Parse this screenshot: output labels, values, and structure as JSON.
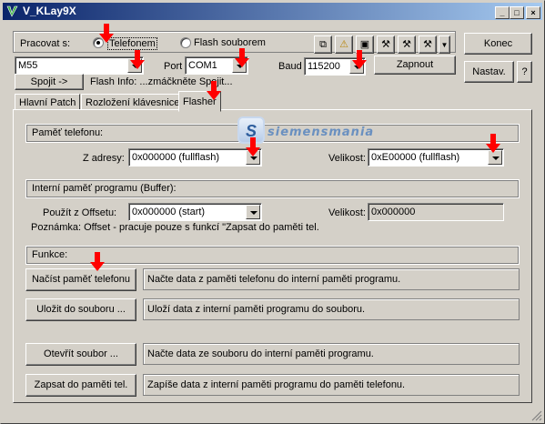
{
  "window": {
    "title": "V_KLay9X"
  },
  "connection": {
    "mode_label": "Pracovat s:",
    "radio_phone": "Telefonem",
    "radio_file": "Flash souborem",
    "model": "M55",
    "port_label": "Port",
    "port": "COM1",
    "baud_label": "Baud",
    "baud": "115200",
    "connect_btn": "Spojit ->",
    "flash_info": "Flash Info: ...zmáčkněte Spojit...",
    "zapnout": "Zapnout",
    "konec": "Konec",
    "nastav": "Nastav.",
    "help": "?"
  },
  "tabs": [
    "Hlavní Patch",
    "Rozložení klávesnice",
    "Flasher"
  ],
  "logo_text": "siemensmania",
  "flasher": {
    "pamet_group": "Paměť telefonu:",
    "z_adresy_label": "Z adresy:",
    "z_adresy": "0x000000 (fullflash)",
    "velikost_label": "Velikost:",
    "velikost": "0xE00000 (fullflash)",
    "buffer_group": "Interní paměť programu (Buffer):",
    "offset_label": "Použít z Offsetu:",
    "offset": "0x000000 (start)",
    "velikost2_label": "Velikost:",
    "velikost2": "0x000000",
    "poznamka": "Poznámka: Offset - pracuje pouze s funkcí \"Zapsat do paměti tel.",
    "funkce_group": "Funkce:",
    "actions": [
      {
        "button": "Načíst paměť telefonu",
        "desc": "Načte data z paměti telefonu do interní paměti programu."
      },
      {
        "button": "Uložit do souboru ...",
        "desc": "Uloží data z interní paměti programu do souboru."
      },
      {
        "button": "Otevřít soubor ...",
        "desc": "Načte data ze souboru do interní paměti programu."
      },
      {
        "button": "Zapsat do paměti tel.",
        "desc": "Zapíše data z interní paměti programu do paměti telefonu."
      }
    ]
  },
  "toolbar_icons": [
    "tool-1-icon",
    "tool-2-icon",
    "tool-3-icon",
    "tool-4-icon",
    "tool-5-icon",
    "tool-6-icon"
  ],
  "colors": {
    "titlebar": "#0a246a",
    "arrow": "#ff0000",
    "face": "#d4d0c8"
  }
}
